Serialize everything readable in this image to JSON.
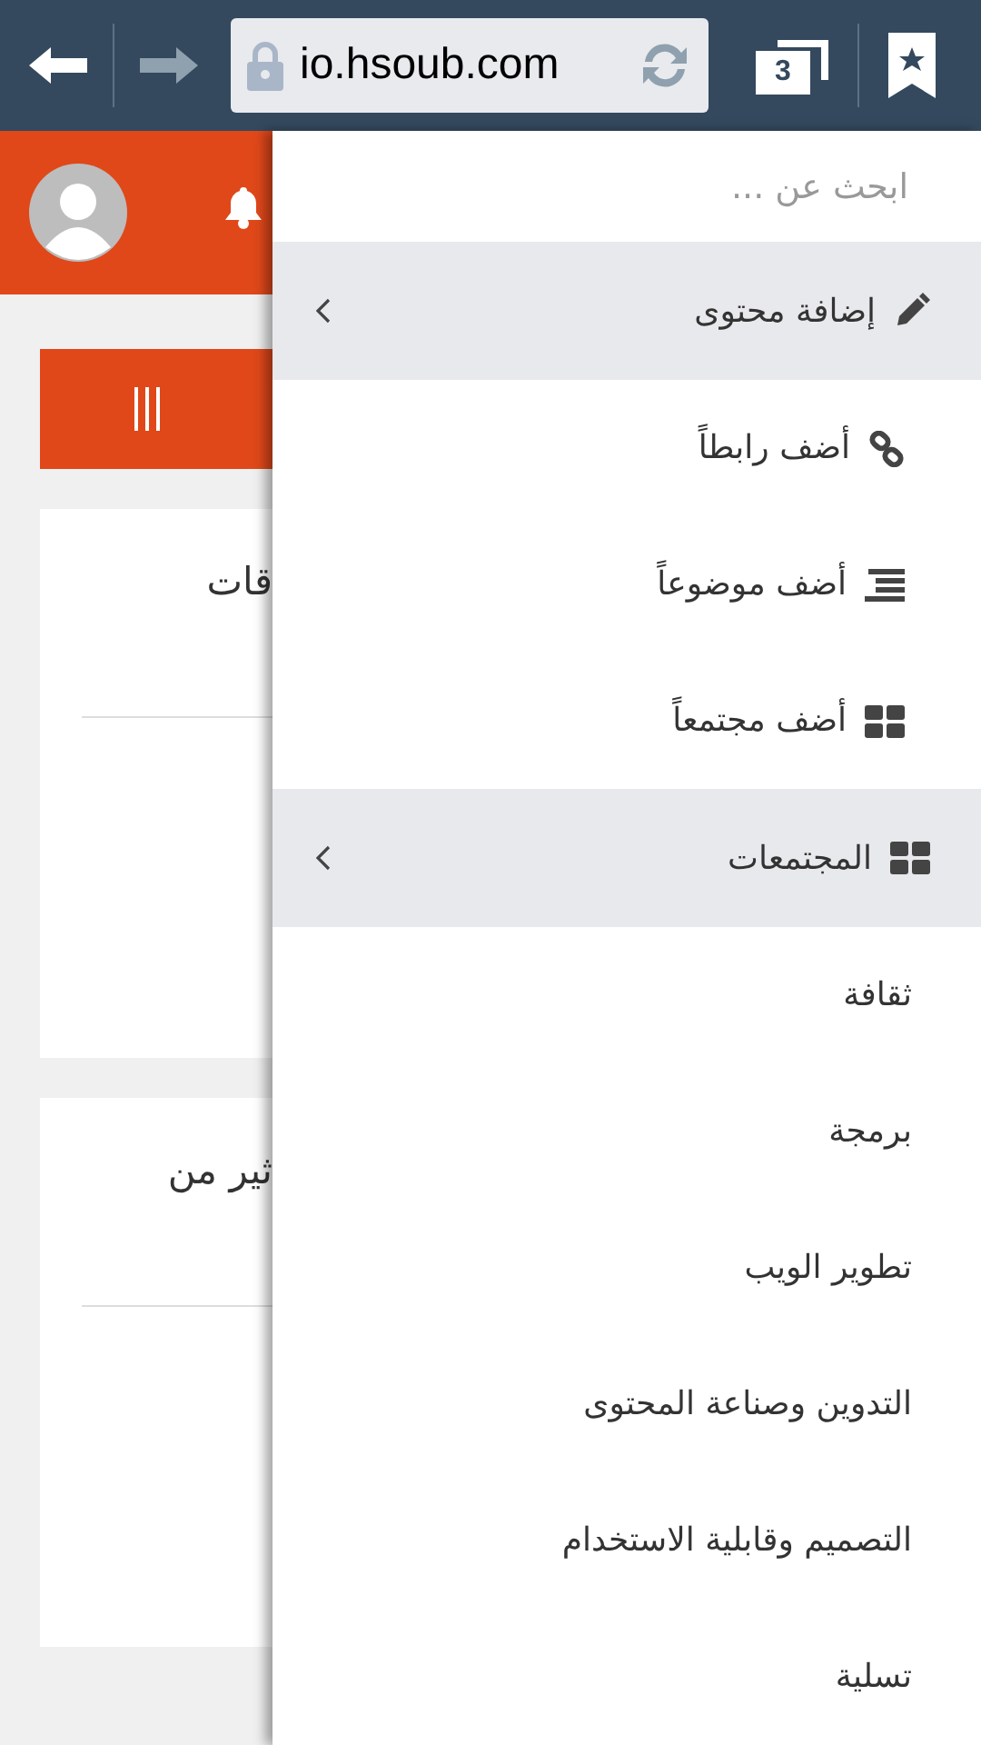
{
  "browser": {
    "url": "io.hsoub.com",
    "tab_count": "3"
  },
  "page": {
    "cards": [
      {
        "text": "قات"
      },
      {
        "text": "ثير من"
      }
    ]
  },
  "drawer": {
    "search": {
      "placeholder": "ابحث عن ..."
    },
    "menu": [
      {
        "kind": "section",
        "label": "إضافة محتوى"
      },
      {
        "kind": "action",
        "label": "أضف رابطاً"
      },
      {
        "kind": "action",
        "label": "أضف موضوعاً"
      },
      {
        "kind": "action",
        "label": "أضف مجتمعاً"
      },
      {
        "kind": "section",
        "label": "المجتمعات"
      },
      {
        "kind": "link",
        "label": "ثقافة"
      },
      {
        "kind": "link",
        "label": "برمجة"
      },
      {
        "kind": "link",
        "label": "تطوير الويب"
      },
      {
        "kind": "link",
        "label": "التدوين وصناعة المحتوى"
      },
      {
        "kind": "link",
        "label": "التصميم وقابلية الاستخدام"
      },
      {
        "kind": "link",
        "label": "تسلية"
      }
    ]
  }
}
